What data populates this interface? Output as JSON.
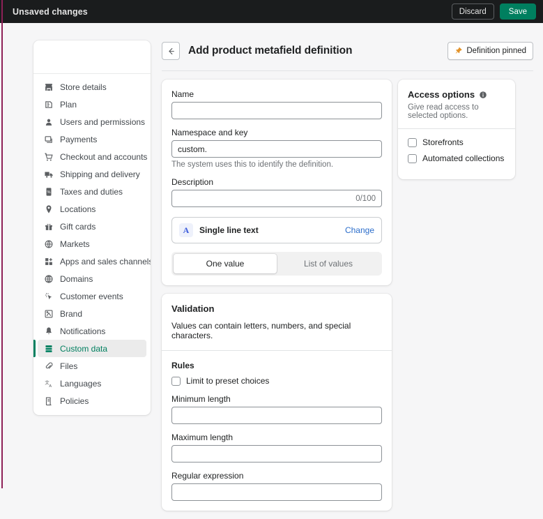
{
  "topbar": {
    "title": "Unsaved changes",
    "discard_label": "Discard",
    "save_label": "Save",
    "background": "#1a1c1d",
    "save_color": "#007f5f",
    "edge_accent": "#8e2157"
  },
  "sidebar": {
    "items": [
      {
        "label": "Store details",
        "icon": "store-icon",
        "active": false
      },
      {
        "label": "Plan",
        "icon": "plan-icon",
        "active": false
      },
      {
        "label": "Users and permissions",
        "icon": "user-icon",
        "active": false
      },
      {
        "label": "Payments",
        "icon": "payments-icon",
        "active": false
      },
      {
        "label": "Checkout and accounts",
        "icon": "cart-icon",
        "active": false
      },
      {
        "label": "Shipping and delivery",
        "icon": "truck-icon",
        "active": false
      },
      {
        "label": "Taxes and duties",
        "icon": "taxes-icon",
        "active": false
      },
      {
        "label": "Locations",
        "icon": "location-pin-icon",
        "active": false
      },
      {
        "label": "Gift cards",
        "icon": "gift-icon",
        "active": false
      },
      {
        "label": "Markets",
        "icon": "globe-icon",
        "active": false
      },
      {
        "label": "Apps and sales channels",
        "icon": "apps-icon",
        "active": false
      },
      {
        "label": "Domains",
        "icon": "domain-globe-icon",
        "active": false
      },
      {
        "label": "Customer events",
        "icon": "customer-events-icon",
        "active": false
      },
      {
        "label": "Brand",
        "icon": "brand-icon",
        "active": false
      },
      {
        "label": "Notifications",
        "icon": "bell-icon",
        "active": false
      },
      {
        "label": "Custom data",
        "icon": "custom-data-icon",
        "active": true
      },
      {
        "label": "Files",
        "icon": "paperclip-icon",
        "active": false
      },
      {
        "label": "Languages",
        "icon": "languages-icon",
        "active": false
      },
      {
        "label": "Policies",
        "icon": "policies-icon",
        "active": false
      }
    ],
    "active_accent": "#008060"
  },
  "header": {
    "back_icon": "arrow-left-icon",
    "title": "Add product metafield definition",
    "pin_button_label": "Definition pinned",
    "pin_icon": "pushpin-icon",
    "pin_icon_color": "#e3932a"
  },
  "definition_form": {
    "name": {
      "label": "Name",
      "value": "",
      "placeholder": ""
    },
    "namespace": {
      "label": "Namespace and key",
      "value": "custom.",
      "help": "The system uses this to identify the definition."
    },
    "description": {
      "label": "Description",
      "value": "",
      "char_count": "0/100"
    },
    "type": {
      "badge": "A",
      "name": "Single line text",
      "change_label": "Change",
      "badge_color": "#3b5bdb",
      "link_color": "#2c6ecb"
    },
    "cardinality": {
      "options": [
        "One value",
        "List of values"
      ],
      "selected": "One value"
    }
  },
  "validation": {
    "title": "Validation",
    "description": "Values can contain letters, numbers, and special characters.",
    "rules_heading": "Rules",
    "limit_choices": {
      "label": "Limit to preset choices",
      "checked": false
    },
    "min_length": {
      "label": "Minimum length",
      "value": ""
    },
    "max_length": {
      "label": "Maximum length",
      "value": ""
    },
    "regex": {
      "label": "Regular expression",
      "value": ""
    }
  },
  "access_options": {
    "title": "Access options",
    "info_icon": "info-icon",
    "subtitle": "Give read access to selected options.",
    "options": [
      {
        "label": "Storefronts",
        "checked": false
      },
      {
        "label": "Automated collections",
        "checked": false
      }
    ]
  }
}
